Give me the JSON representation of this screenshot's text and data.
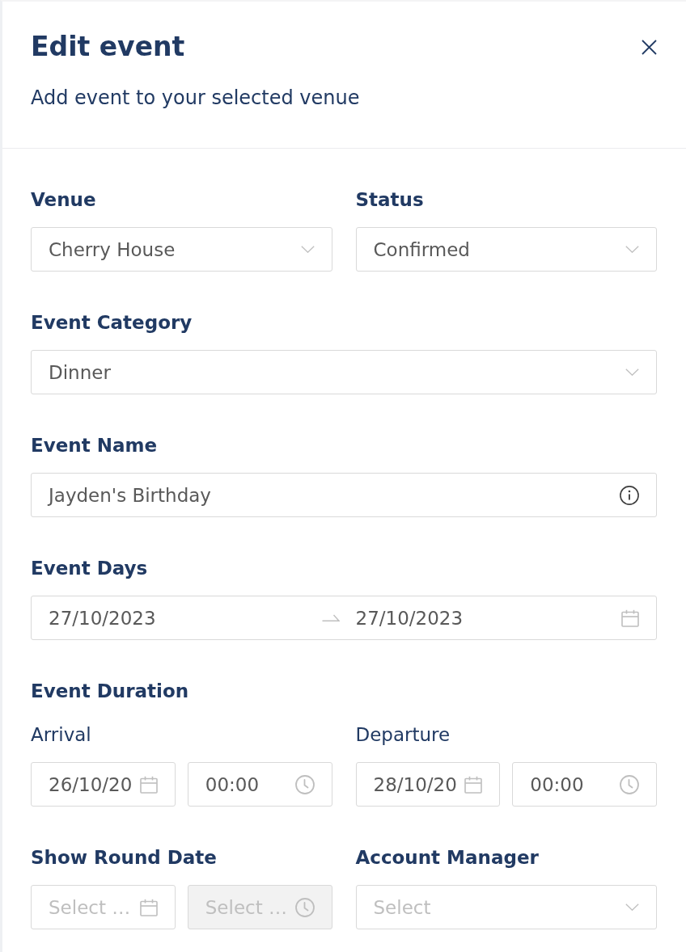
{
  "header": {
    "title": "Edit event",
    "subtitle": "Add event to your selected venue"
  },
  "venue": {
    "label": "Venue",
    "value": "Cherry House"
  },
  "status": {
    "label": "Status",
    "value": "Confirmed"
  },
  "event_category": {
    "label": "Event Category",
    "value": "Dinner"
  },
  "event_name": {
    "label": "Event Name",
    "value": "Jayden's Birthday"
  },
  "event_days": {
    "label": "Event Days",
    "start": "27/10/2023",
    "end": "27/10/2023"
  },
  "event_duration": {
    "label": "Event Duration",
    "arrival": {
      "label": "Arrival",
      "date": "26/10/20",
      "time": "00:00"
    },
    "departure": {
      "label": "Departure",
      "date": "28/10/20",
      "time": "00:00"
    }
  },
  "show_round_date": {
    "label": "Show Round Date",
    "date": {
      "placeholder": "Select …",
      "disabled": false
    },
    "time": {
      "placeholder": "Select …",
      "disabled": true
    }
  },
  "account_manager": {
    "label": "Account Manager",
    "placeholder": "Select"
  }
}
